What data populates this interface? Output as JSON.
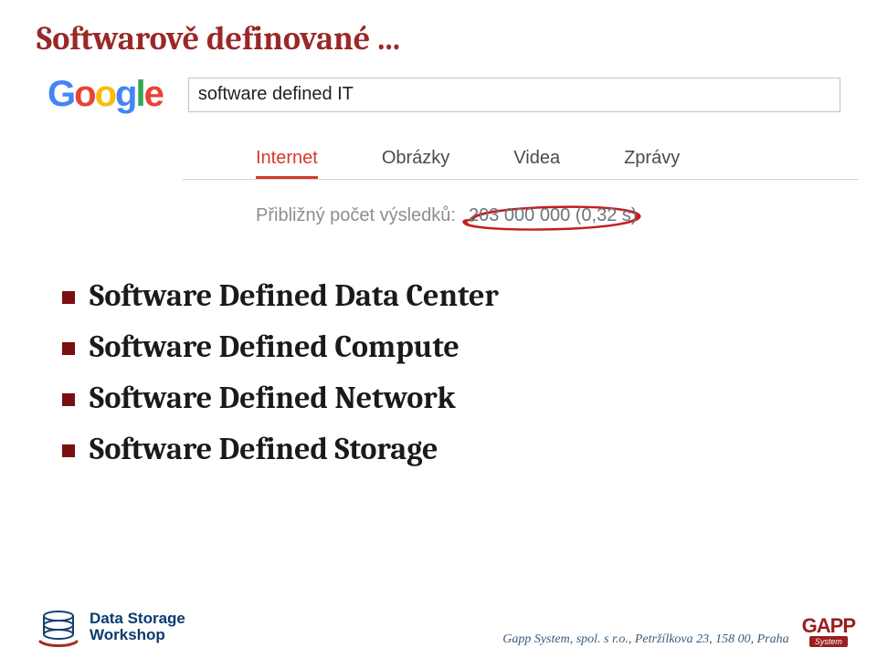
{
  "title": "Softwarově definované ...",
  "google": {
    "letters": [
      "G",
      "o",
      "o",
      "g",
      "l",
      "e"
    ],
    "search_value": "software defined IT"
  },
  "tabs": [
    {
      "label": "Internet",
      "active": true
    },
    {
      "label": "Obrázky",
      "active": false
    },
    {
      "label": "Videa",
      "active": false
    },
    {
      "label": "Zprávy",
      "active": false
    }
  ],
  "results": {
    "prefix": "Přibližný počet výsledků:",
    "count": "203 000 000 (0,32 s)"
  },
  "bullets": [
    "Software Defined Data Center",
    "Software Defined Compute",
    "Software Defined Network",
    "Software Defined Storage"
  ],
  "footer": {
    "dsw_line1": "Data Storage",
    "dsw_line2": "Workshop",
    "tagline": "Gapp System, spol. s r.o., Petržílkova 23, 158 00, Praha",
    "gapp": "GAPP",
    "gapp_sub": "System"
  }
}
